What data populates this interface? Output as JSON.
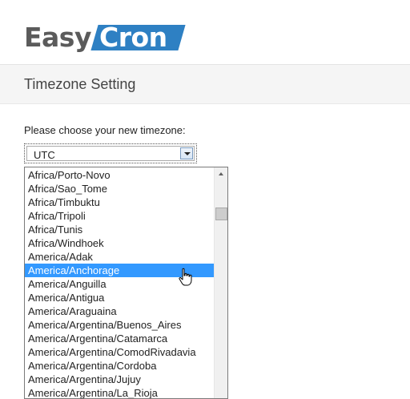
{
  "brand": {
    "part1": "Easy",
    "part2": "Cron",
    "accent": "#2e80c3"
  },
  "page": {
    "title": "Timezone Setting"
  },
  "form": {
    "prompt": "Please choose your new timezone:",
    "selected_value": "UTC",
    "highlighted_option": "America/Anchorage",
    "options": [
      "Africa/Porto-Novo",
      "Africa/Sao_Tome",
      "Africa/Timbuktu",
      "Africa/Tripoli",
      "Africa/Tunis",
      "Africa/Windhoek",
      "America/Adak",
      "America/Anchorage",
      "America/Anguilla",
      "America/Antigua",
      "America/Araguaina",
      "America/Argentina/Buenos_Aires",
      "America/Argentina/Catamarca",
      "America/Argentina/ComodRivadavia",
      "America/Argentina/Cordoba",
      "America/Argentina/Jujuy",
      "America/Argentina/La_Rioja"
    ]
  },
  "icons": {
    "scroll_up": "chevron-up-icon",
    "dropdown_arrow": "chevron-down-icon",
    "cursor": "hand-pointer-icon"
  }
}
